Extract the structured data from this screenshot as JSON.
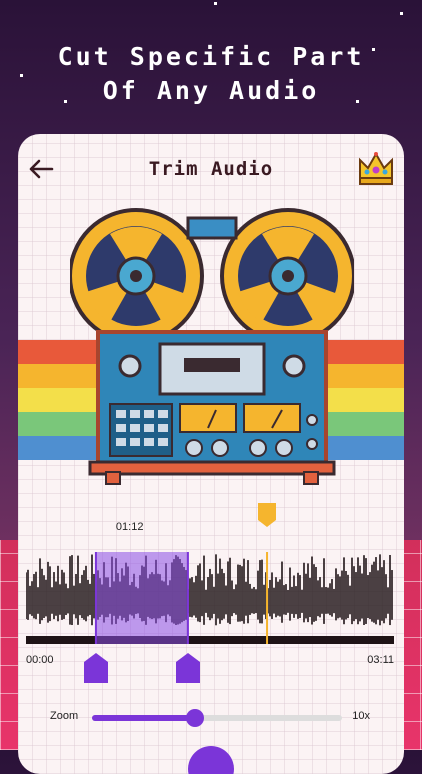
{
  "promo": {
    "line1": "Cut Specific Part",
    "line2": "Of Any Audio"
  },
  "header": {
    "title": "Trim Audio",
    "back_icon": "arrow-left-icon",
    "premium_icon": "crown-icon"
  },
  "editor": {
    "selection_time": "01:12",
    "start_time": "00:00",
    "end_time": "03:11",
    "playhead_fraction": 0.655,
    "selection_start_fraction": 0.19,
    "selection_end_fraction": 0.44
  },
  "zoom": {
    "label": "Zoom",
    "max_label": "10x",
    "level_fraction": 0.41
  },
  "colors": {
    "accent_purple": "#7b35d8",
    "playhead_orange": "#f5b52e",
    "waveform": "#1f1416"
  }
}
